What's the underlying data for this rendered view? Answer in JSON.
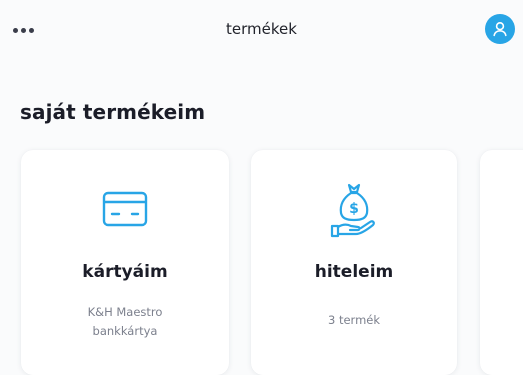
{
  "header": {
    "title": "termékek"
  },
  "section": {
    "title": "saját termékeim"
  },
  "cards": [
    {
      "title": "kártyáim",
      "subtitle_line1": "K&H Maestro",
      "subtitle_line2": "bankkártya",
      "icon": "credit-card-icon"
    },
    {
      "title": "hiteleim",
      "subtitle_line1": "3 termék",
      "icon": "money-bag-hand-icon"
    }
  ],
  "colors": {
    "accent": "#28a5e6",
    "title": "#1b1d28",
    "muted": "#7c808d",
    "background": "#fafbfc"
  }
}
